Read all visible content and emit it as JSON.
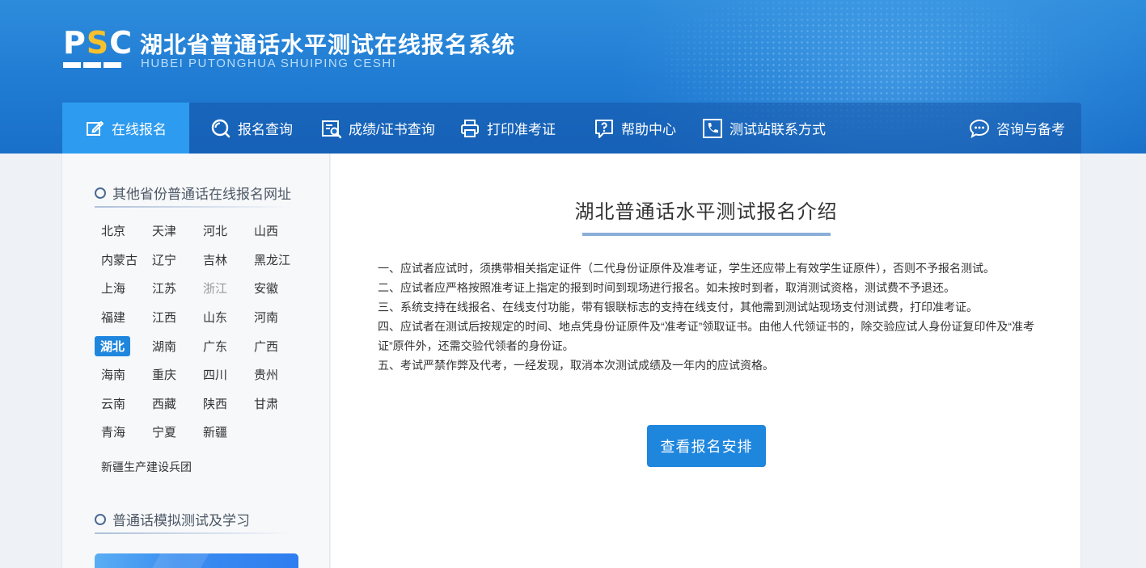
{
  "brand": {
    "logo_text_p": "P",
    "logo_text_s": "S",
    "logo_text_c": "C",
    "title": "湖北省普通话水平测试在线报名系统",
    "subtitle": "HUBEI PUTONGHUA SHUIPING CESHI",
    "colors": {
      "header": "#1f7bd2",
      "accent": "#2d9bf0",
      "logo_s": "#f7c12d"
    }
  },
  "nav": {
    "items": [
      {
        "label": "在线报名",
        "icon": "edit-icon",
        "active": true
      },
      {
        "label": "报名查询",
        "icon": "search-icon",
        "active": false
      },
      {
        "label": "成绩/证书查询",
        "icon": "certificate-search-icon",
        "active": false
      },
      {
        "label": "打印准考证",
        "icon": "printer-icon",
        "active": false
      },
      {
        "label": "帮助中心",
        "icon": "help-icon",
        "active": false
      },
      {
        "label": "测试站联系方式",
        "icon": "phone-icon",
        "active": false
      }
    ],
    "consult_label": "咨询与备考",
    "consult_icon": "chat-icon"
  },
  "sidebar": {
    "section1_title": "其他省份普通话在线报名网址",
    "provinces": [
      "北京",
      "天津",
      "河北",
      "山西",
      "内蒙古",
      "辽宁",
      "吉林",
      "黑龙江",
      "上海",
      "江苏",
      "浙江",
      "安徽",
      "福建",
      "江西",
      "山东",
      "河南",
      "湖北",
      "湖南",
      "广东",
      "广西",
      "海南",
      "重庆",
      "四川",
      "贵州",
      "云南",
      "西藏",
      "陕西",
      "甘肃",
      "青海",
      "宁夏",
      "新疆"
    ],
    "selected_province": "湖北",
    "disabled_province": "浙江",
    "extra_item": "新疆生产建设兵团",
    "section2_title": "普通话模拟测试及学习"
  },
  "main": {
    "title": "湖北普通话水平测试报名介绍",
    "rules": [
      "一、应试者应试时，须携带相关指定证件（二代身份证原件及准考证，学生还应带上有效学生证原件），否则不予报名测试。",
      "二、应试者应严格按照准考证上指定的报到时间到现场进行报名。如未按时到者，取消测试资格，测试费不予退还。",
      "三、系统支持在线报名、在线支付功能，带有银联标志的支持在线支付，其他需到测试站现场支付测试费，打印准考证。",
      "四、应试者在测试后按规定的时间、地点凭身份证原件及“准考证”领取证书。由他人代领证书的，除交验应试人身份证复印件及“准考证”原件外，还需交验代领者的身份证。",
      "五、考试严禁作弊及代考，一经发现，取消本次测试成绩及一年内的应试资格。"
    ],
    "button_label": "查看报名安排"
  }
}
